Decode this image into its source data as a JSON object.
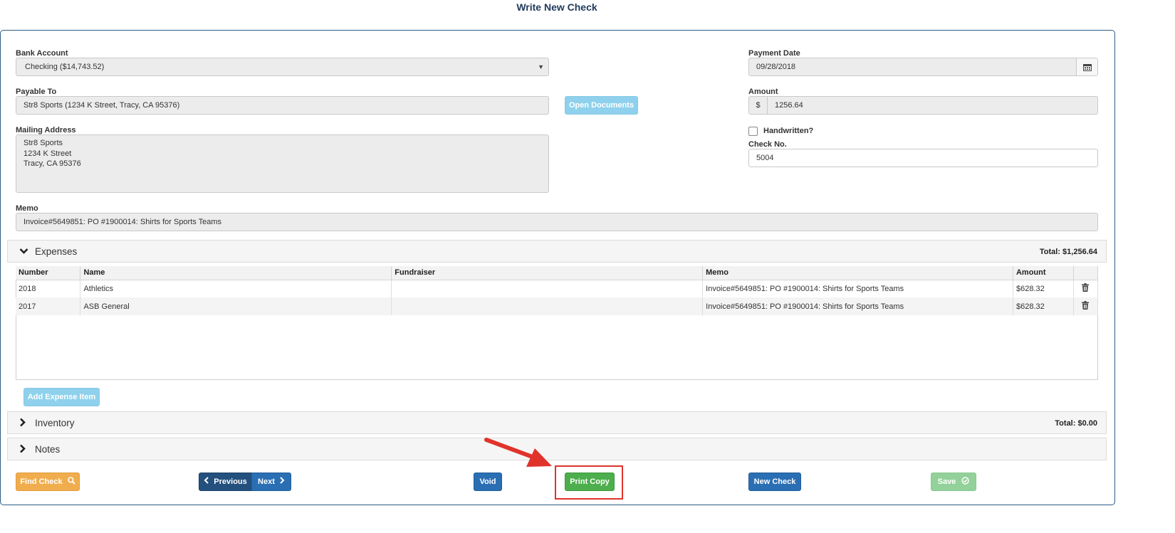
{
  "page": {
    "title": "Write New Check"
  },
  "form": {
    "bank_account": {
      "label": "Bank Account",
      "value": "Checking ($14,743.52)"
    },
    "payment_date": {
      "label": "Payment Date",
      "value": "09/28/2018"
    },
    "payable_to": {
      "label": "Payable To",
      "value": "Str8 Sports (1234 K Street, Tracy, CA 95376)"
    },
    "open_documents": "Open Documents",
    "amount": {
      "label": "Amount",
      "currency": "$",
      "value": "1256.64"
    },
    "mailing_address": {
      "label": "Mailing Address",
      "lines": [
        "Str8 Sports",
        "1234 K Street",
        "Tracy, CA 95376"
      ]
    },
    "handwritten": {
      "label": "Handwritten?",
      "checked": false
    },
    "check_no": {
      "label": "Check No.",
      "value": "5004"
    },
    "memo": {
      "label": "Memo",
      "value": "Invoice#5649851: PO #1900014: Shirts for Sports Teams"
    }
  },
  "expenses": {
    "title": "Expenses",
    "total": "Total: $1,256.64",
    "columns": [
      "Number",
      "Name",
      "Fundraiser",
      "Memo",
      "Amount"
    ],
    "rows": [
      {
        "number": "2018",
        "name": "Athletics",
        "fundraiser": "",
        "memo": "Invoice#5649851: PO #1900014: Shirts for Sports Teams",
        "amount": "$628.32"
      },
      {
        "number": "2017",
        "name": "ASB General",
        "fundraiser": "",
        "memo": "Invoice#5649851: PO #1900014: Shirts for Sports Teams",
        "amount": "$628.32"
      }
    ],
    "add_button": "Add Expense Item"
  },
  "inventory": {
    "title": "Inventory",
    "total": "Total: $0.00"
  },
  "notes": {
    "title": "Notes"
  },
  "footer": {
    "find_check": "Find Check",
    "previous": "Previous",
    "next": "Next",
    "void": "Void",
    "print_copy": "Print Copy",
    "new_check": "New Check",
    "save": "Save"
  },
  "colors": {
    "accent": "#2a6fb4",
    "highlight": "#e0332b",
    "success": "#4cae4c",
    "warning": "#f0ad4e"
  }
}
